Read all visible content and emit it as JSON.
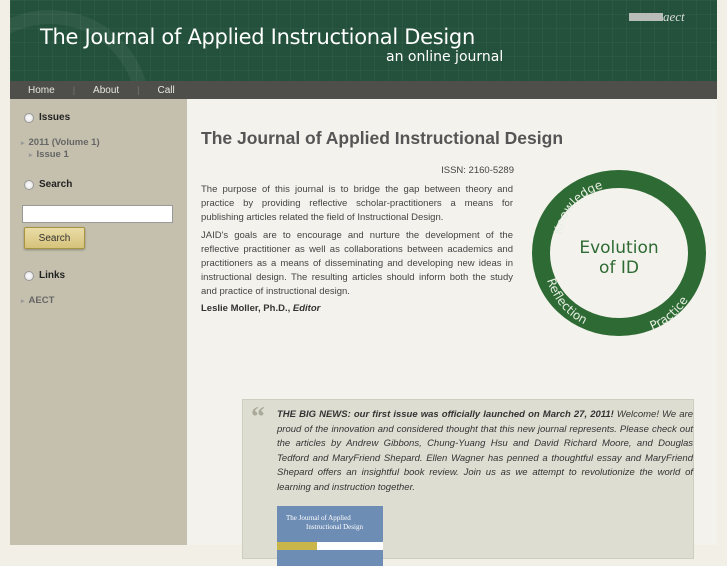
{
  "header": {
    "title": "The Journal of Applied Instructional Design",
    "subtitle": "an online journal",
    "logo_text": "aect"
  },
  "nav": {
    "items": [
      {
        "label": "Home"
      },
      {
        "label": "About"
      },
      {
        "label": "Call"
      }
    ]
  },
  "sidebar": {
    "issues": {
      "heading": "Issues",
      "volume": "2011 (Volume 1)",
      "issue": "Issue 1"
    },
    "search": {
      "heading": "Search",
      "input_value": "",
      "button_label": "Search"
    },
    "links": {
      "heading": "Links",
      "items": [
        {
          "label": "AECT"
        }
      ]
    }
  },
  "main": {
    "title": "The Journal of Applied Instructional Design",
    "issn": "ISSN: 2160-5289",
    "paragraphs": [
      "The purpose of this journal is to bridge the gap between theory and practice by providing reflective scholar-practitioners a means for publishing articles related the field of Instructional Design.",
      "JAID's goals are to encourage and nurture the development of the reflective practitioner as well as collaborations between academics and practitioners as a means of disseminating and developing new ideas in instructional design.  The resulting articles should inform both the study and practice of instructional design."
    ],
    "editor_name": "Leslie Moller, Ph.D.,",
    "editor_role": "Editor",
    "logo": {
      "center_line1": "Evolution",
      "center_line2": "of ID",
      "words": [
        "Knowledge",
        "Reflection",
        "Practice"
      ],
      "color": "#2e6b34"
    },
    "news": {
      "headline": "THE BIG NEWS: our first issue was officially launched on March 27, 2011!",
      "body": "Welcome!  We are proud of the innovation and considered thought that this new journal represents.   Please check out the articles by Andrew Gibbons, Chung-Yuang Hsu and David Richard Moore, and Douglas Tedford and MaryFriend Shepard.   Ellen Wagner has penned a thoughtful essay and MaryFriend Shepard offers an insightful book review.  Join us as we attempt to revolutionize the world of learning and instruction together.",
      "cover_line1": "The Journal of Applied",
      "cover_line2": "Instructional Design"
    }
  }
}
